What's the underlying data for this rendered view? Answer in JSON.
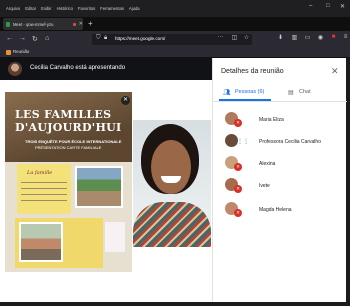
{
  "browser": {
    "menu": [
      "Arquivo",
      "Editar",
      "Exibir",
      "Histórico",
      "Favoritos",
      "Ferramentas",
      "Ajuda"
    ],
    "tab_title": "Meet - qow-mmef-yzu",
    "url": "https://meet.google.com/",
    "bookmark": "Reunião"
  },
  "presenter": {
    "text": "Cecilia Carvalho está apresentando"
  },
  "document": {
    "title_line1": "LES FAMILLES",
    "title_line2": "D'AUJOURD'HUI",
    "subtitle_line1": "TROIS ENQUÊTE POUR ÉCOLE INTERNATIONALE",
    "subtitle_line2": "PRÉSENTATION CARTE FAMILIALE",
    "card_label": "La famille"
  },
  "panel": {
    "title": "Detalhes da reunião",
    "tab_people": "Pessoas (6)",
    "tab_chat": "Chat",
    "participants": [
      {
        "name": "Maria Eliza",
        "avatar_color": "#b07a5c",
        "muted": true
      },
      {
        "name": "Professora Cecilia Carvalho",
        "avatar_color": "#6b4a3a",
        "muted": false
      },
      {
        "name": "Alexina",
        "avatar_color": "#c9a07c",
        "muted": true
      },
      {
        "name": "Ivete",
        "avatar_color": "#a66b4e",
        "muted": true
      },
      {
        "name": "Magda Helena",
        "avatar_color": "#c2866a",
        "muted": true
      }
    ]
  },
  "colors": {
    "accent": "#1a73e8",
    "mute_red": "#d93025"
  }
}
